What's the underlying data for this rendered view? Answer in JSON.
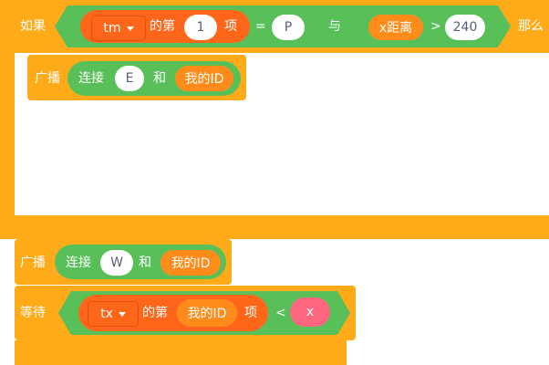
{
  "if_block": {
    "keyword_if": "如果",
    "keyword_then": "那么",
    "list_var": "tm",
    "of_the": "的第",
    "index": "1",
    "item": "项",
    "equals": "=",
    "compare_value": "P",
    "and_op": "与",
    "distance_var": "x距离",
    "gt": ">",
    "gt_value": "240"
  },
  "inner_broadcast": {
    "label": "广播",
    "join": "连接",
    "first": "E",
    "and": "和",
    "second": "我的ID"
  },
  "broadcast2": {
    "label": "广播",
    "join": "连接",
    "first": "W",
    "and": "和",
    "second": "我的ID"
  },
  "wait_block": {
    "keyword_wait": "等待",
    "list_var": "tx",
    "of_the": "的第",
    "index_var": "我的ID",
    "item": "项",
    "lt": "<",
    "compare_var": "x"
  },
  "colors": {
    "control": "#ffab19",
    "operator": "#59c059",
    "list": "#ff661a",
    "variable": "#ff8c1a",
    "custom_reporter": "#ff6680"
  }
}
